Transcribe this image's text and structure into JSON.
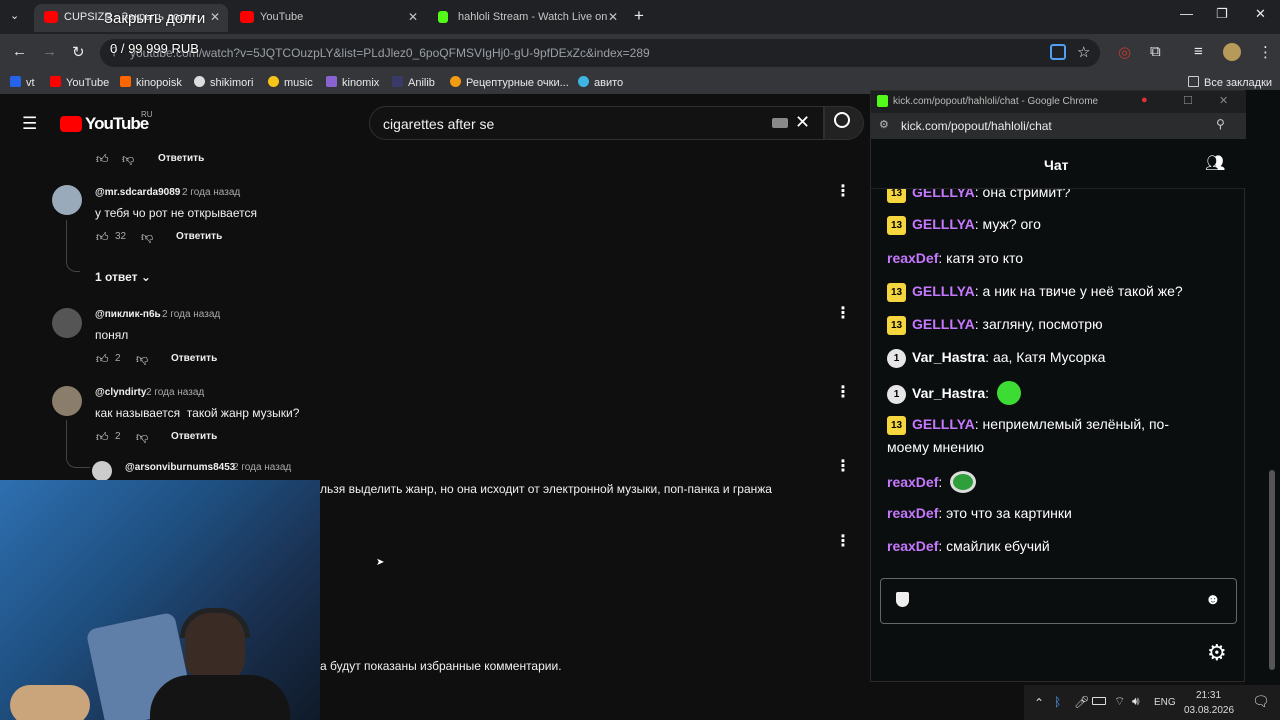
{
  "chrome": {
    "tabs": [
      {
        "label": "CUPSIZE - Закрыть долги",
        "color": "#ff0000"
      },
      {
        "label": "YouTube",
        "color": "#ff0000"
      },
      {
        "label": "hahloli Stream - Watch Live on",
        "color": "#53fc18"
      }
    ],
    "new_tab": "+",
    "url": "youtube.com/watch?v=5JQTCOuzpLY&list=PLdJlez0_6poQFMSVIgHj0-gU-9pfDExZc&index=289",
    "bookmarks": [
      "vt",
      "YouTube",
      "kinopoisk",
      "shikimori",
      "music",
      "kinomix",
      "Anilib",
      "Рецептурные очки...",
      "авито"
    ],
    "all_bookmarks": "Все закладки",
    "overlay_title": "Закрыть долги",
    "overlay_progress": "0 / 99 999 RUB"
  },
  "youtube": {
    "logo": "YouTube",
    "region": "RU",
    "search_value": "cigarettes after se",
    "reply_label": "Ответить",
    "comments": [
      {
        "author": "@mr.sdcarda9089",
        "time": "2 года назад",
        "text": "у тебя чо рот не открывается",
        "likes": "32"
      },
      {
        "author": "@пиклик-п6ь",
        "time": "2 года назад",
        "text": "понял",
        "likes": "2"
      },
      {
        "author": "@clyndirty",
        "time": "2 года назад",
        "text": "как называется  такой жанр музыки?",
        "likes": "2"
      }
    ],
    "replies_toggle": "1 ответ",
    "nested_reply": {
      "author": "@arsonviburnums8453",
      "time": "2 года назад",
      "text": "льзя выделить жанр, но она исходит от электронной музыки, поп-панка и гранжа"
    },
    "footer_note": "а будут показаны избранные комментарии."
  },
  "kick": {
    "window_title": "kick.com/popout/hahloli/chat - Google Chrome",
    "url": "kick.com/popout/hahloli/chat",
    "chat_title": "Чат",
    "messages": [
      {
        "badge": "13",
        "user": "GELLLYA",
        "text": ": она стримит?",
        "color": "#c678ff"
      },
      {
        "badge": "13",
        "user": "GELLLYA",
        "text": ": муж? ого",
        "color": "#c678ff"
      },
      {
        "badge": "",
        "user": "reaxDef",
        "text": ": катя это кто",
        "color": "#c678ff"
      },
      {
        "badge": "13",
        "user": "GELLLYA",
        "text": ": а ник на твиче у неё такой же?",
        "color": "#c678ff"
      },
      {
        "badge": "13",
        "user": "GELLLYA",
        "text": ": загляну, посмотрю",
        "color": "#c678ff"
      },
      {
        "badge": "1",
        "user": "Var_Hastra",
        "text": ": аа, Катя Мусорка",
        "color": "#ffffff"
      },
      {
        "badge": "1",
        "user": "Var_Hastra",
        "text": ":",
        "color": "#ffffff"
      },
      {
        "badge": "13",
        "user": "GELLLYA",
        "text": ": неприемлемый зелёный, по-",
        "color": "#c678ff"
      },
      {
        "badge": "",
        "user": "",
        "text": "моему мнению",
        "color": "#ffffff"
      },
      {
        "badge": "",
        "user": "reaxDef",
        "text": ":",
        "color": "#c678ff"
      },
      {
        "badge": "",
        "user": "reaxDef",
        "text": ": это что за картинки",
        "color": "#c678ff"
      },
      {
        "badge": "",
        "user": "reaxDef",
        "text": ": смайлик ебучий",
        "color": "#c678ff"
      }
    ]
  },
  "taskbar": {
    "lang": "ENG",
    "time": "21:31",
    "date": "03.08.2026"
  }
}
